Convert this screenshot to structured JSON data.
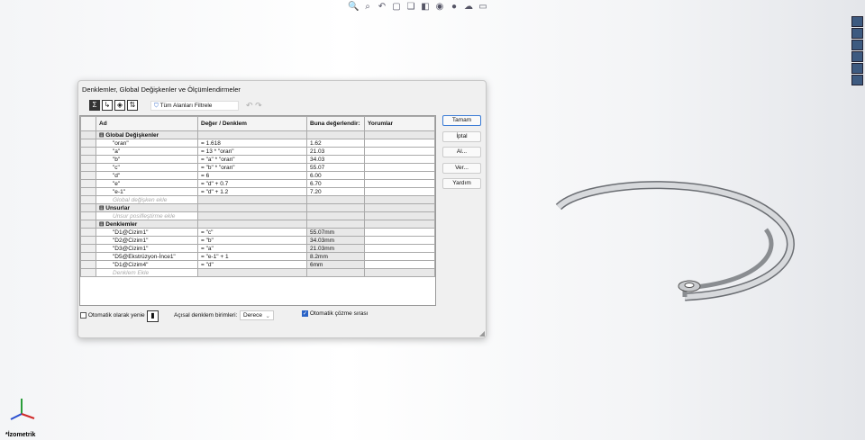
{
  "dialog": {
    "title": "Denklemler, Global Değişkenler ve Ölçümlendirmeler",
    "filter": "Tüm Alanları Filtrele",
    "columns": [
      "Ad",
      "Değer / Denklem",
      "Buna değerlendir:",
      "Yorumlar"
    ],
    "groups": [
      {
        "label": "Global Değişkenler",
        "rows": [
          [
            "\"oran\"",
            "= 1.618",
            "1.62"
          ],
          [
            "\"a\"",
            "= 13 * \"oran\"",
            "21.03"
          ],
          [
            "\"b\"",
            "= \"a\" * \"oran\"",
            "34.03"
          ],
          [
            "\"c\"",
            "= \"b\" * \"oran\"",
            "55.07"
          ],
          [
            "\"d\"",
            "= 6",
            "6.00"
          ],
          [
            "\"e\"",
            "= \"d\" + 0.7",
            "6.70"
          ],
          [
            "\"e-1\"",
            "= \"d\" + 1.2",
            "7.20"
          ]
        ],
        "add": "Global değişken ekle"
      },
      {
        "label": "Unsurlar",
        "rows": [],
        "add": "Unsur posifleştirme ekle"
      },
      {
        "label": "Denklemler",
        "rows": [
          [
            "\"D1@Cizim1\"",
            "= \"c\"",
            "55.07mm"
          ],
          [
            "\"D2@Cizim1\"",
            "= \"b\"",
            "34.03mm"
          ],
          [
            "\"D3@Cizim1\"",
            "= \"a\"",
            "21.03mm"
          ],
          [
            "\"D5@Ekstrüzyon-İnce1\"",
            "= \"e-1\" + 1",
            "8.2mm"
          ],
          [
            "\"D1@Cizim4\"",
            "= \"d\"",
            "6mm"
          ]
        ],
        "add": "Denklem Ekle"
      }
    ],
    "buttons": [
      "Tamam",
      "İptal",
      "Al...",
      "Ver...",
      "Yardım"
    ],
    "auto_rebuild": "Otomatik olarak yenie",
    "angular_label": "Açısal denklem birimleri:",
    "angular_value": "Derece",
    "auto_solve": "Otomatik çözme sırası"
  },
  "view": {
    "orientation": "*İzometrik"
  }
}
